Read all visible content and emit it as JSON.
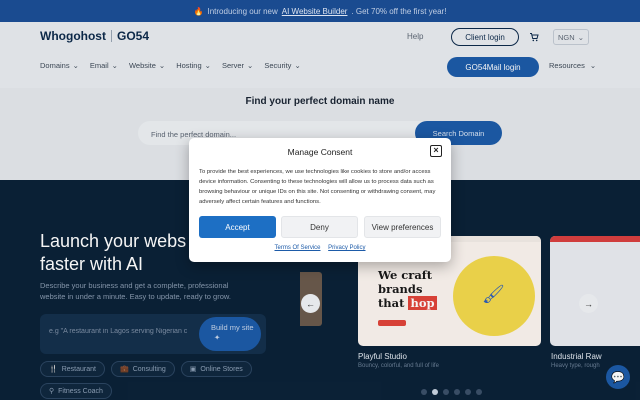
{
  "promo": {
    "emoji": "🔥",
    "prefix": "Introducing our new",
    "link": "AI Website Builder",
    "suffix": ". Get 70% off the first year!"
  },
  "header": {
    "logo_primary": "Whogohost",
    "logo_secondary": "GO54",
    "help": "Help",
    "client_login": "Client login",
    "cart_icon": "cart-icon",
    "currency": "NGN",
    "nav": [
      "Domains",
      "Email",
      "Website",
      "Hosting",
      "Server",
      "Security"
    ],
    "go54mail_login": "GO54Mail login",
    "resources": "Resources"
  },
  "domain": {
    "title": "Find your perfect domain name",
    "placeholder": "Find the perfect domain...",
    "button": "Search Domain"
  },
  "hero": {
    "title": "Launch your webs\nfaster with AI",
    "subtitle": "Describe your business and get a complete, professional website in under a minute. Easy to update, ready to grow.",
    "prompt_placeholder": "e.g \"A restaurant in Lagos serving Nigerian c",
    "build_button": "Build my site",
    "chips": [
      {
        "icon": "fork-icon",
        "label": "Restaurant"
      },
      {
        "icon": "briefcase-icon",
        "label": "Consulting"
      },
      {
        "icon": "store-icon",
        "label": "Online Stores"
      },
      {
        "icon": "dumbbell-icon",
        "label": "Fitness Coach"
      }
    ]
  },
  "carousel": {
    "card_main": {
      "line1": "We craft",
      "line2": "brands",
      "line3_pre": "that",
      "line3_hl": "hop",
      "caption": "Playful Studio",
      "sub": "Bouncy, colorful, and full of life"
    },
    "card_right": {
      "caption": "Industrial Raw",
      "sub": "Heavy type, rough"
    },
    "dots": 6,
    "active_dot": 1
  },
  "consent": {
    "title": "Manage Consent",
    "body": "To provide the best experiences, we use technologies like cookies to store and/or access device information. Consenting to these technologies will allow us to process data such as browsing behaviour or unique IDs on this site. Not consenting or withdrawing consent, may adversely affect certain features and functions.",
    "accept": "Accept",
    "deny": "Deny",
    "preferences": "View preferences",
    "terms": "Terms Of Service",
    "privacy": "Privacy Policy"
  },
  "colors": {
    "brand_blue": "#1d5ba8",
    "hero_bg": "#0b2238",
    "promo_bg": "#1c4f96"
  }
}
